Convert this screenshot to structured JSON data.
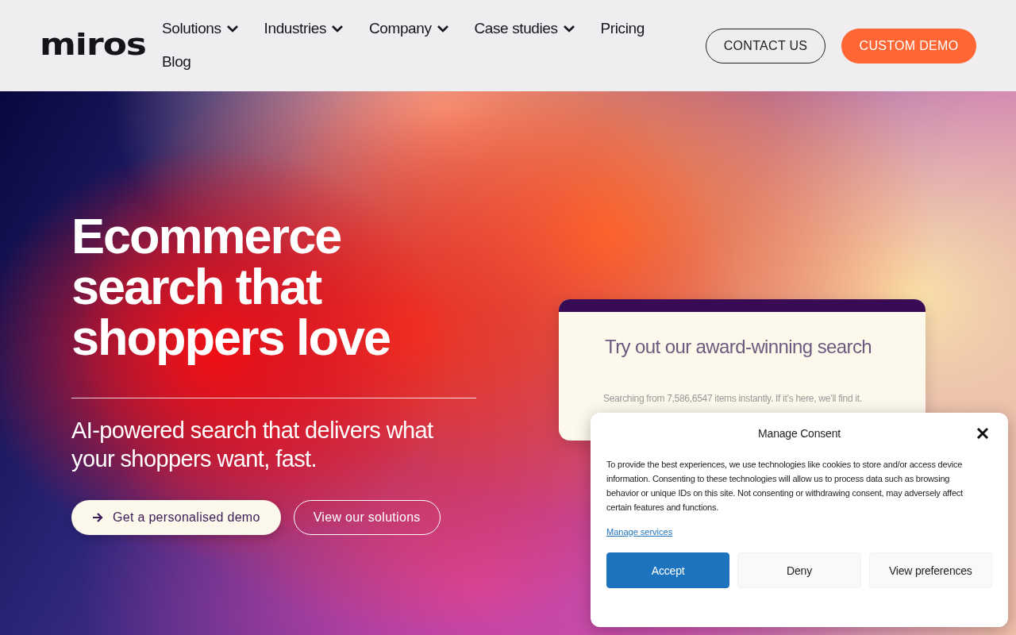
{
  "header": {
    "logo": "miros",
    "nav": [
      {
        "label": "Solutions",
        "dropdown": true
      },
      {
        "label": "Industries",
        "dropdown": true
      },
      {
        "label": "Company",
        "dropdown": true
      },
      {
        "label": "Case studies",
        "dropdown": true
      },
      {
        "label": "Pricing",
        "dropdown": false
      },
      {
        "label": "Blog",
        "dropdown": false
      }
    ],
    "buttons": [
      {
        "label": "CONTACT US",
        "kind": "outline"
      },
      {
        "label": "CUSTOM DEMO",
        "kind": "filled"
      }
    ]
  },
  "hero": {
    "heading": [
      "Ecommerce",
      "search that",
      "shoppers love"
    ],
    "subtitle": "AI-powered search that delivers what your shoppers want, fast.",
    "buttons": [
      {
        "label": "Get a personalised demo",
        "kind": "primary"
      },
      {
        "label": "View our solutions",
        "kind": "outline"
      }
    ]
  },
  "search_card": {
    "title": "Try out our award-winning search",
    "note": "Searching from 7,586,6547 items instantly. If it’s here, we’ll find it."
  },
  "consent": {
    "title": "Manage Consent",
    "body": "To provide the best experiences, we use technologies like cookies to store and/or access device information. Consenting to these technologies will allow us to process data such as browsing behavior or unique IDs on this site. Not consenting or withdrawing consent, may adversely affect certain features and functions.",
    "link": "Manage services",
    "buttons": [
      {
        "label": "Accept",
        "kind": "primary"
      },
      {
        "label": "Deny",
        "kind": "plain"
      },
      {
        "label": "View preferences",
        "kind": "plain"
      }
    ]
  }
}
